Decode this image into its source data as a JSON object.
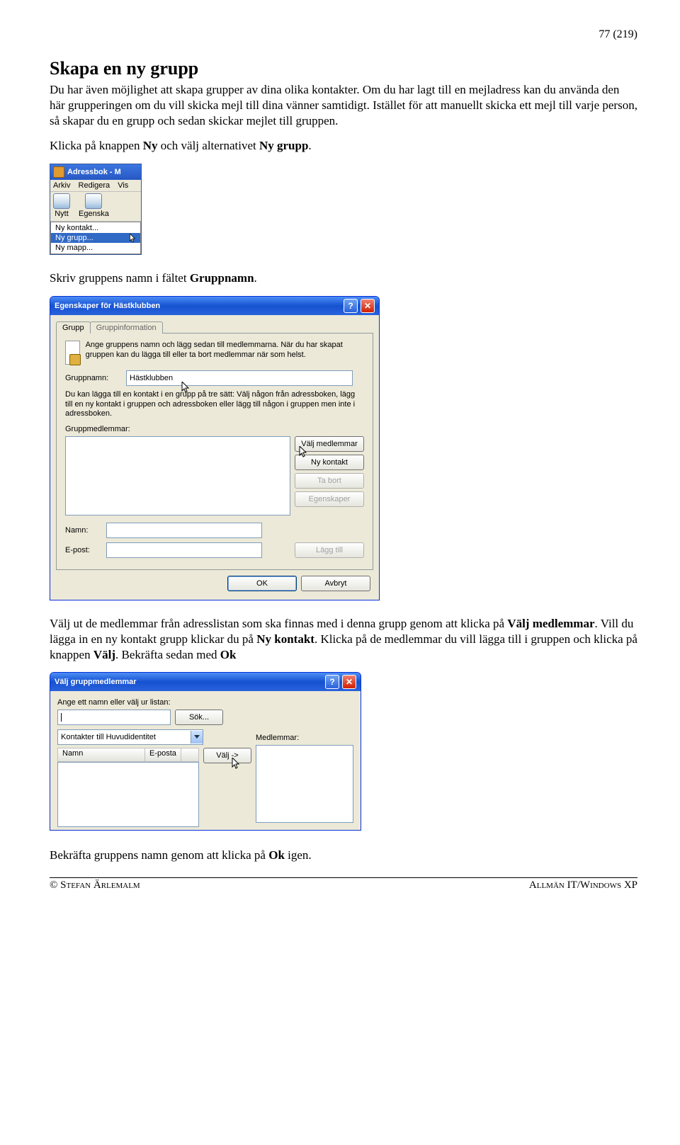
{
  "page_number": "77 (219)",
  "heading": "Skapa en ny grupp",
  "intro": "Du har även möjlighet att skapa grupper av dina olika kontakter. Om du har lagt till en mejladress kan du använda den här grupperingen om du vill skicka mejl till dina vänner samtidigt. Istället för att manuellt skicka ett mejl till varje person, så skapar du en grupp och sedan skickar mejlet till gruppen.",
  "p_click_ny": {
    "pre": "Klicka på knappen ",
    "b1": "Ny",
    "mid": " och välj alternativet ",
    "b2": "Ny grupp",
    "post": "."
  },
  "shot1": {
    "title": "Adressbok - M",
    "menu": {
      "arkiv": "Arkiv",
      "redigera": "Redigera",
      "vis": "Vis"
    },
    "toolbar": {
      "nytt": "Nytt",
      "egenska": "Egenska"
    },
    "dropdown": {
      "ny_kontakt": "Ny kontakt...",
      "ny_grupp": "Ny grupp...",
      "ny_mapp": "Ny mapp..."
    }
  },
  "p_gruppnamn": {
    "pre": "Skriv gruppens namn i fältet ",
    "b1": "Gruppnamn",
    "post": "."
  },
  "shot2": {
    "title": "Egenskaper för Hästklubben",
    "tab_grupp": "Grupp",
    "tab_info": "Gruppinformation",
    "desc": "Ange gruppens namn och lägg sedan till medlemmarna. När du har skapat gruppen kan du lägga till eller ta bort medlemmar när som helst.",
    "lbl_gruppnamn": "Gruppnamn:",
    "val_gruppnamn": "Hästklubben",
    "note": "Du kan lägga till en kontakt i en grupp på tre sätt: Välj någon från adressboken, lägg till en ny kontakt i gruppen och adressboken eller lägg till någon i gruppen men inte i adressboken.",
    "lbl_medlemmar": "Gruppmedlemmar:",
    "btn_valj": "Välj medlemmar",
    "btn_nykontakt": "Ny kontakt",
    "btn_tabort": "Ta bort",
    "btn_egenskaper": "Egenskaper",
    "lbl_namn": "Namn:",
    "lbl_epost": "E-post:",
    "btn_laggtill": "Lägg till",
    "btn_ok": "OK",
    "btn_avbryt": "Avbryt"
  },
  "p_valjmedlemmar": {
    "t1": "Välj ut de medlemmar från adresslistan som ska finnas med i denna grupp genom att klicka på ",
    "b1": "Välj medlemmar",
    "t2": ". Vill du lägga in en ny kontakt grupp klickar du på ",
    "b2": "Ny kontakt",
    "t3": ". Klicka på de medlemmar du vill lägga till i gruppen och klicka på knappen ",
    "b3": "Välj",
    "t4": ". Bekräfta sedan med ",
    "b4": "Ok"
  },
  "shot3": {
    "title": "Välj gruppmedlemmar",
    "lab_ange": "Ange ett namn eller välj ur listan:",
    "btn_sok": "Sök...",
    "combo": "Kontakter till Huvudidentitet",
    "col_namn": "Namn",
    "col_eposta": "E-posta",
    "btn_valj": "Välj ->",
    "lbl_medlemmar": "Medlemmar:"
  },
  "p_bekrafta": {
    "t1": "Bekräfta gruppens namn genom att klicka på ",
    "b1": "Ok",
    "t2": " igen."
  },
  "footer": {
    "left": "© Stefan Ärlemalm",
    "right": "Allmän IT/Windows XP"
  }
}
